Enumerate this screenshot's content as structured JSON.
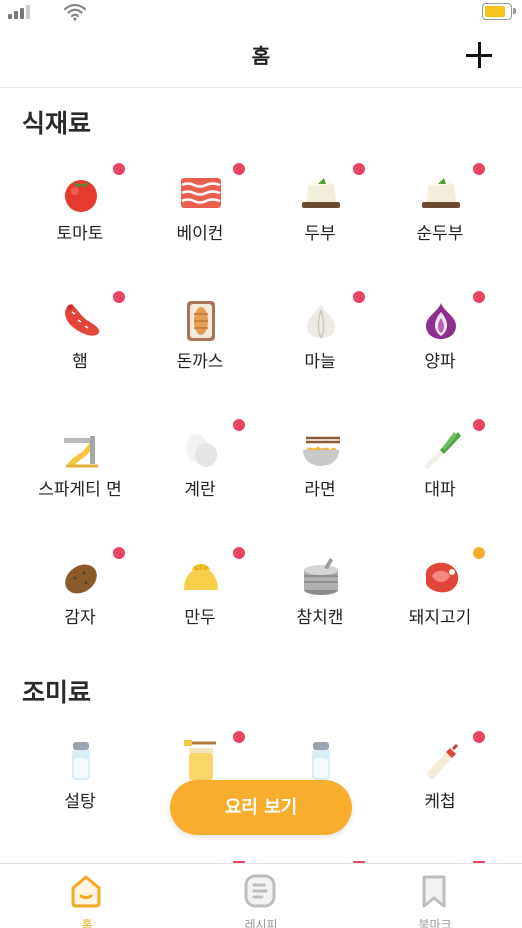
{
  "colors": {
    "accent": "#F8AE2C",
    "badge": "#E84563",
    "badge_alt": "#F6AD2E"
  },
  "header": {
    "title": "홈"
  },
  "sections": [
    {
      "title": "식재료",
      "items": [
        {
          "label": "토마토",
          "icon": "tomato-icon"
        },
        {
          "label": "베이컨",
          "icon": "bacon-icon"
        },
        {
          "label": "두부",
          "icon": "tofu-icon"
        },
        {
          "label": "순두부",
          "icon": "soft-tofu-icon"
        },
        {
          "label": "햄",
          "icon": "sausage-icon"
        },
        {
          "label": "돈까스",
          "icon": "pork-cutlet-icon"
        },
        {
          "label": "마늘",
          "icon": "garlic-icon"
        },
        {
          "label": "양파",
          "icon": "onion-icon"
        },
        {
          "label": "스파게티 면",
          "icon": "spaghetti-icon"
        },
        {
          "label": "계란",
          "icon": "egg-icon"
        },
        {
          "label": "라면",
          "icon": "ramen-icon"
        },
        {
          "label": "대파",
          "icon": "green-onion-icon"
        },
        {
          "label": "감자",
          "icon": "potato-icon"
        },
        {
          "label": "만두",
          "icon": "dumpling-icon"
        },
        {
          "label": "참치캔",
          "icon": "tuna-can-icon"
        },
        {
          "label": "돼지고기",
          "icon": "pork-icon"
        }
      ]
    },
    {
      "title": "조미료",
      "items": [
        {
          "label": "설탕",
          "icon": "sugar-shaker-icon"
        },
        {
          "label": "",
          "icon": "oil-bottle-icon"
        },
        {
          "label": "",
          "icon": "salt-shaker-icon"
        },
        {
          "label": "케첩",
          "icon": "ketchup-icon"
        }
      ]
    }
  ],
  "fab": {
    "label": "요리 보기"
  },
  "tabs": [
    {
      "label": "홈",
      "icon": "home-icon"
    },
    {
      "label": "레시피",
      "icon": "recipe-icon"
    },
    {
      "label": "북마크",
      "icon": "bookmark-icon"
    }
  ]
}
